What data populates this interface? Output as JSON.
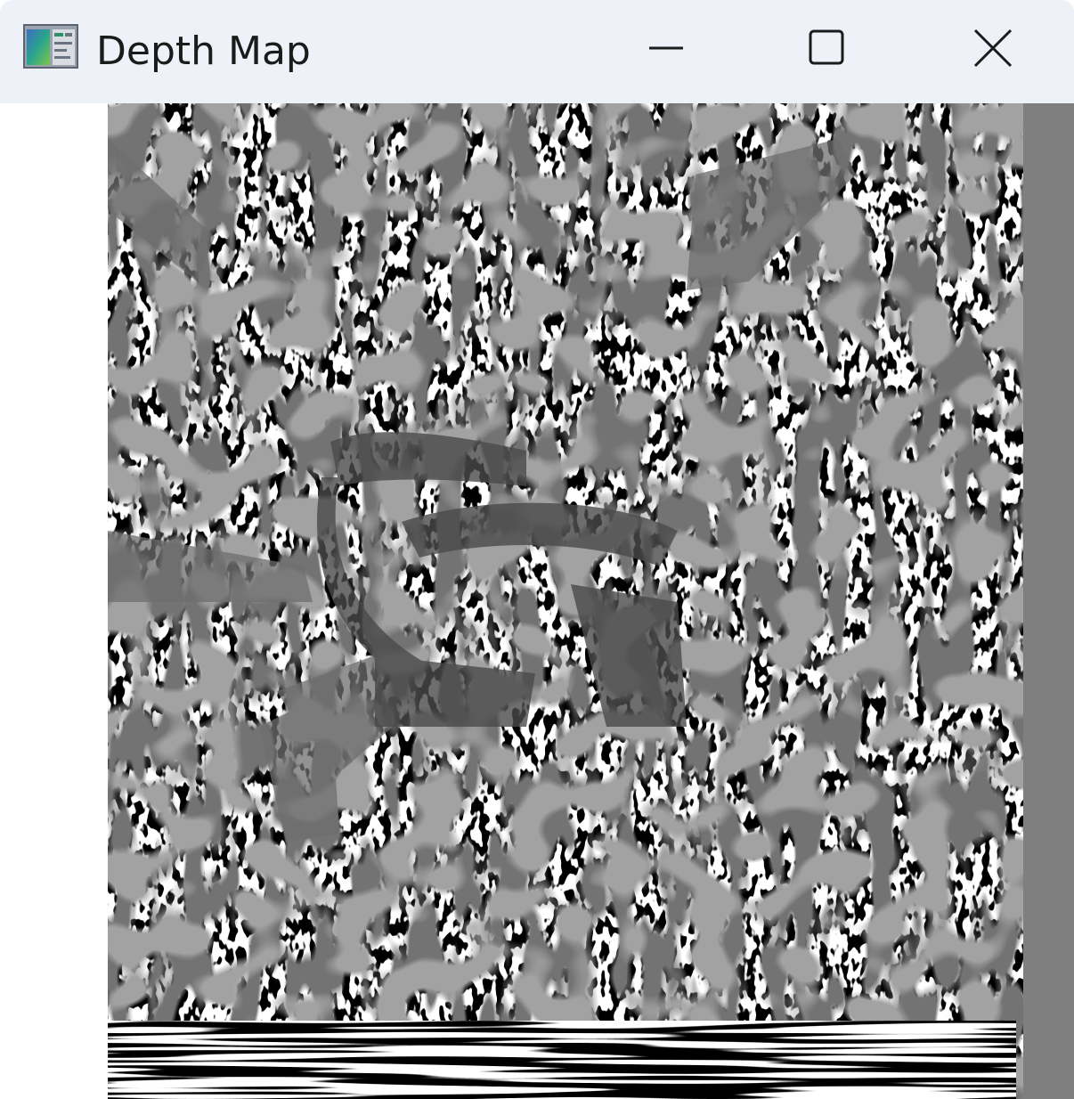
{
  "window": {
    "title": "Depth Map",
    "app_icon": "depth-map-app-icon",
    "controls": {
      "minimize": "minimize-icon",
      "maximize": "maximize-icon",
      "close": "close-icon"
    },
    "titlebar_color": "#eff1f9"
  },
  "content": {
    "image": "depth-map-image",
    "palette": [
      "#000000",
      "#ffffff",
      "#7f7f7f",
      "#444444",
      "#2a2a2a",
      "#5c5c5c"
    ]
  }
}
